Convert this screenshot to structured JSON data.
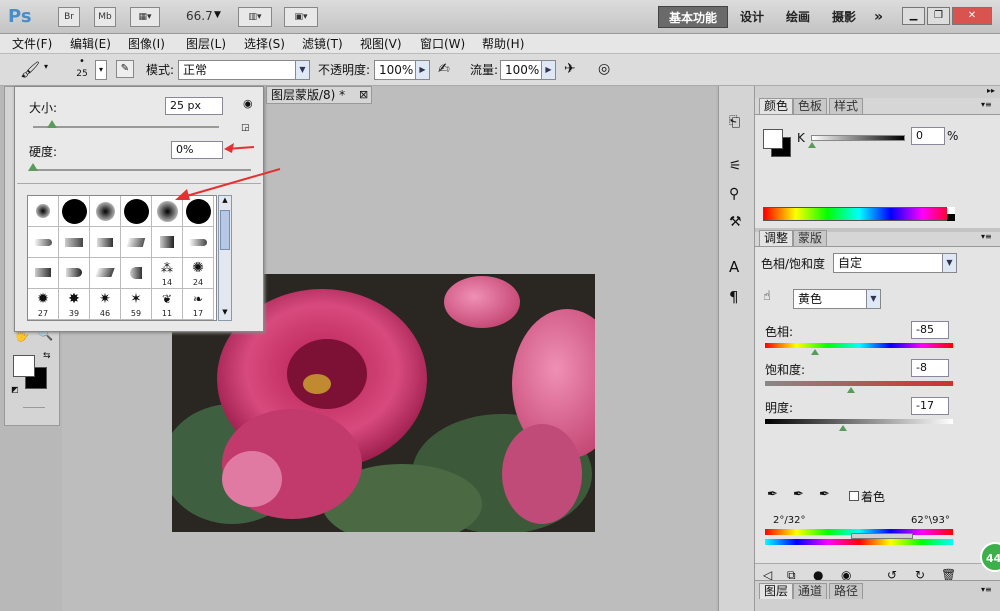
{
  "titlebar": {
    "logo": "Ps",
    "bridge": "Br",
    "minibridge": "Mb",
    "zoom": "66.7",
    "workspaces": [
      "基本功能",
      "设计",
      "绘画",
      "摄影"
    ],
    "more": "»"
  },
  "menu": [
    "文件(F)",
    "编辑(E)",
    "图像(I)",
    "图层(L)",
    "选择(S)",
    "滤镜(T)",
    "视图(V)",
    "窗口(W)",
    "帮助(H)"
  ],
  "options": {
    "brush_size": "25",
    "mode_label": "模式:",
    "mode_value": "正常",
    "opacity_label": "不透明度:",
    "opacity_value": "100%",
    "flow_label": "流量:",
    "flow_value": "100%"
  },
  "document": {
    "tab_title": "图层蒙版/8) *",
    "close": "⊠"
  },
  "brush_popup": {
    "size_label": "大小:",
    "size_value": "25 px",
    "hardness_label": "硬度:",
    "hardness_value": "0%",
    "size_fraction": 0.1,
    "hardness_fraction": 0.0,
    "brush_numbers": [
      "14",
      "24",
      "27",
      "39",
      "46",
      "59",
      "11",
      "17"
    ]
  },
  "color_panel": {
    "tabs": [
      "颜色",
      "色板",
      "样式"
    ],
    "channel_label": "K",
    "channel_value": "0",
    "unit": "%"
  },
  "adjust_panel": {
    "tabs": [
      "调整",
      "蒙版"
    ],
    "title": "色相/饱和度",
    "preset_value": "自定",
    "channel_value": "黄色",
    "hue_label": "色相:",
    "hue_value": "-85",
    "sat_label": "饱和度:",
    "sat_value": "-8",
    "light_label": "明度:",
    "light_value": "-17",
    "colorize_label": "着色",
    "range_left": "2°/32°",
    "range_right": "62°\\93°"
  },
  "layers_panel": {
    "tabs": [
      "图层",
      "通道",
      "路径"
    ]
  },
  "badge": "44",
  "colors": {
    "accent_tab": "#6a6a6a",
    "arrow_red": "#e53030",
    "badge_green": "#3cb04a"
  }
}
